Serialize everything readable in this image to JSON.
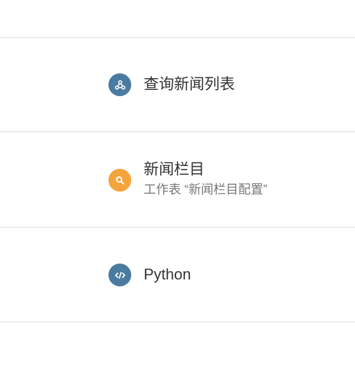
{
  "steps": [
    {
      "title": "查询新闻列表",
      "subtitle": "",
      "icon": "webhook-icon",
      "icon_color": "#4a7ba0"
    },
    {
      "title": "新闻栏目",
      "subtitle": "工作表 “新闻栏目配置”",
      "icon": "search-icon",
      "icon_color": "#f5a33d"
    },
    {
      "title": "Python",
      "subtitle": "",
      "icon": "code-icon",
      "icon_color": "#4a7ba0"
    }
  ]
}
